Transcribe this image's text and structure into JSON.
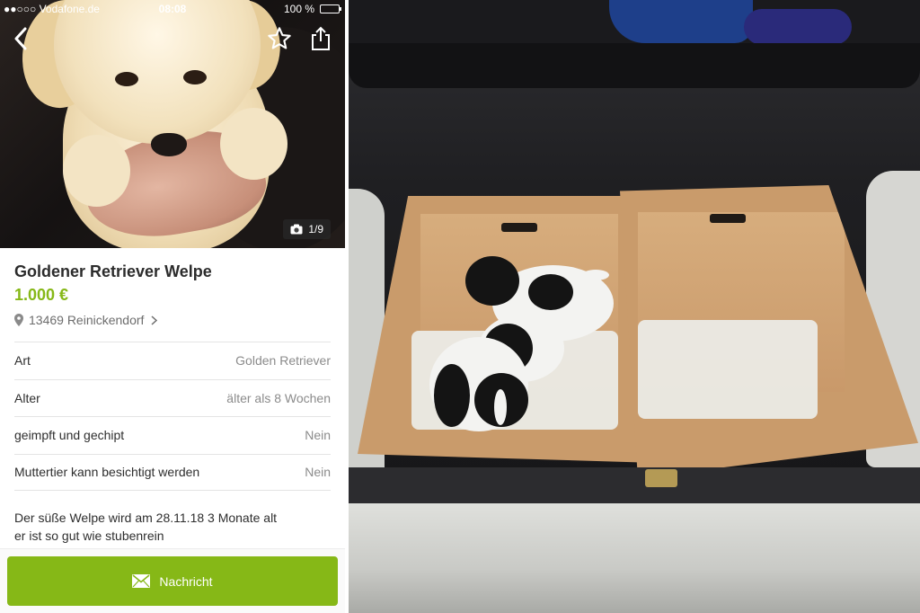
{
  "status_bar": {
    "carrier": "●●○○○ Vodafone.de",
    "time": "08:08",
    "battery": "100 %"
  },
  "gallery": {
    "counter": "1/9"
  },
  "listing": {
    "title": "Goldener Retriever Welpe",
    "price": "1.000 €",
    "location": "13469 Reinickendorf"
  },
  "attributes": [
    {
      "label": "Art",
      "value": "Golden Retriever"
    },
    {
      "label": "Alter",
      "value": "älter als 8 Wochen"
    },
    {
      "label": "geimpft und gechipt",
      "value": "Nein"
    },
    {
      "label": "Muttertier kann besichtigt werden",
      "value": "Nein"
    }
  ],
  "description": {
    "line1": "Der süße Welpe wird am 28.11.18 3 Monate alt",
    "line2": "er ist so gut wie stubenrein"
  },
  "actions": {
    "message_label": "Nachricht"
  },
  "colors": {
    "accent": "#86b817",
    "text": "#2c2c2c",
    "muted": "#8b8b8b"
  },
  "icons": [
    "back-icon",
    "star-icon",
    "share-icon",
    "camera-icon",
    "location-pin-icon",
    "envelope-icon"
  ]
}
